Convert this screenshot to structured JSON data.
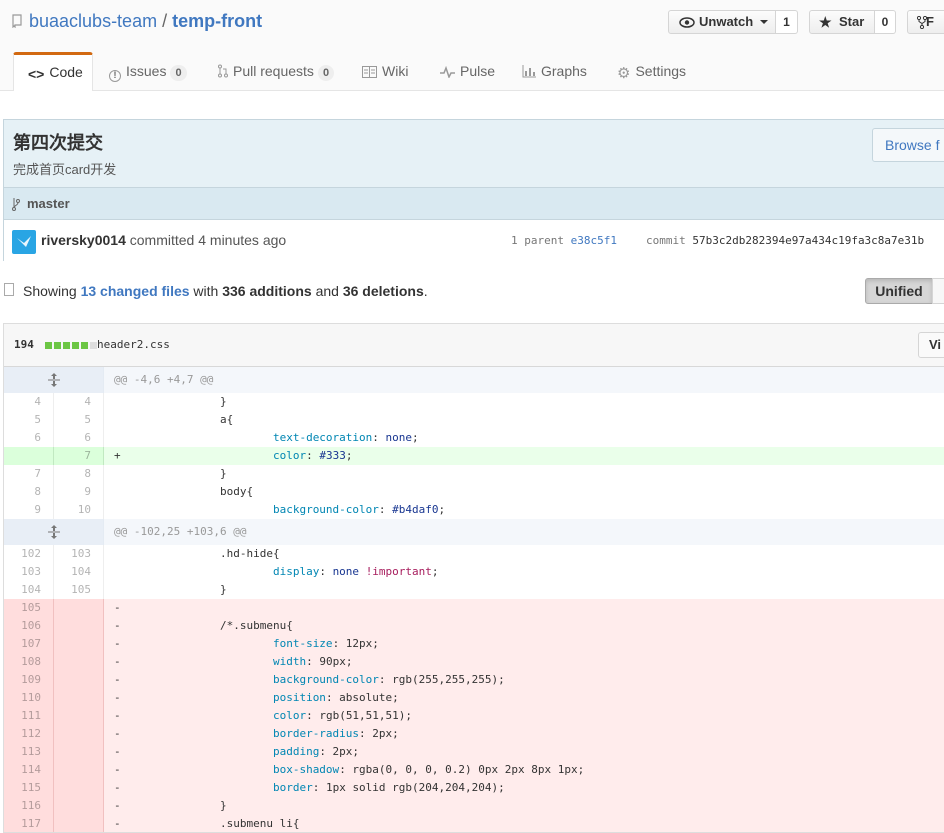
{
  "repo": {
    "owner": "buaaclubs-team",
    "separator": "/",
    "name": "temp-front"
  },
  "actions": {
    "unwatch_label": "Unwatch",
    "watch_count": "1",
    "star_label": "Star",
    "star_count": "0",
    "fork_label": "F"
  },
  "tabs": [
    {
      "label": "Code",
      "icon": "code-icon",
      "selected": true
    },
    {
      "label": "Issues",
      "icon": "issue-icon",
      "count": "0"
    },
    {
      "label": "Pull requests",
      "icon": "pull-request-icon",
      "count": "0"
    },
    {
      "label": "Wiki",
      "icon": "book-icon"
    },
    {
      "label": "Pulse",
      "icon": "pulse-icon"
    },
    {
      "label": "Graphs",
      "icon": "graph-icon"
    },
    {
      "label": "Settings",
      "icon": "gear-icon"
    }
  ],
  "commit": {
    "title": "第四次提交",
    "description": "完成首页card开发",
    "browse_label": "Browse f",
    "branch": "master",
    "author": "riversky0014",
    "committed_text": "committed 4 minutes ago",
    "parent_label": "1 parent",
    "parent_sha": "e38c5f1",
    "commit_label": "commit",
    "commit_sha": "57b3c2db282394e97a434c19fa3c8a7e31b"
  },
  "toc": {
    "showing": "Showing",
    "changed_files": "13 changed files",
    "with": "with",
    "additions": "336 additions",
    "and": "and",
    "deletions": "36 deletions",
    "period": ".",
    "unified_label": "Unified"
  },
  "file": {
    "diffstat": "194",
    "blocks": [
      "add",
      "add",
      "add",
      "add",
      "add",
      "neutral"
    ],
    "name": "header2.css",
    "view_label": "Vi"
  },
  "colors": {
    "add": "#6cc644",
    "neutral": "#dddddd",
    "accent": "#4078c0",
    "tab_accent": "#d26911"
  },
  "diff_rows": [
    {
      "type": "hunk",
      "text": "@@ -4,6 +4,7 @@"
    },
    {
      "type": "ctx",
      "o": "4",
      "n": "4",
      "text": "  \t\t}"
    },
    {
      "type": "ctx",
      "o": "5",
      "n": "5",
      "text": "  \t\ta{"
    },
    {
      "type": "ctx",
      "o": "6",
      "n": "6",
      "text": "  \t\t\ttext-decoration: none;"
    },
    {
      "type": "add",
      "o": "",
      "n": "7",
      "text": "+ \t\t\tcolor: #333;"
    },
    {
      "type": "ctx",
      "o": "7",
      "n": "8",
      "text": "  \t\t}"
    },
    {
      "type": "ctx",
      "o": "8",
      "n": "9",
      "text": "  \t\tbody{"
    },
    {
      "type": "ctx",
      "o": "9",
      "n": "10",
      "text": "  \t\t\tbackground-color: #b4daf0;"
    },
    {
      "type": "hunk",
      "text": "@@ -102,25 +103,6 @@"
    },
    {
      "type": "ctx",
      "o": "102",
      "n": "103",
      "text": "  \t\t.hd-hide{"
    },
    {
      "type": "ctx",
      "o": "103",
      "n": "104",
      "text": "  \t\t\tdisplay: none !important;"
    },
    {
      "type": "ctx",
      "o": "104",
      "n": "105",
      "text": "  \t\t}"
    },
    {
      "type": "del",
      "o": "105",
      "n": "",
      "text": "-"
    },
    {
      "type": "del",
      "o": "106",
      "n": "",
      "text": "- \t\t/*.submenu{"
    },
    {
      "type": "del",
      "o": "107",
      "n": "",
      "text": "- \t\t\tfont-size: 12px;"
    },
    {
      "type": "del",
      "o": "108",
      "n": "",
      "text": "- \t\t\twidth: 90px;"
    },
    {
      "type": "del",
      "o": "109",
      "n": "",
      "text": "- \t\t\tbackground-color: rgb(255,255,255);"
    },
    {
      "type": "del",
      "o": "110",
      "n": "",
      "text": "- \t\t\tposition: absolute;"
    },
    {
      "type": "del",
      "o": "111",
      "n": "",
      "text": "- \t\t\tcolor: rgb(51,51,51);"
    },
    {
      "type": "del",
      "o": "112",
      "n": "",
      "text": "- \t\t\tborder-radius: 2px;"
    },
    {
      "type": "del",
      "o": "113",
      "n": "",
      "text": "- \t\t\tpadding: 2px;"
    },
    {
      "type": "del",
      "o": "114",
      "n": "",
      "text": "- \t\t\tbox-shadow: rgba(0, 0, 0, 0.2) 0px 2px 8px 1px;"
    },
    {
      "type": "del",
      "o": "115",
      "n": "",
      "text": "- \t\t\tborder: 1px solid rgb(204,204,204);"
    },
    {
      "type": "del",
      "o": "116",
      "n": "",
      "text": "- \t\t}"
    },
    {
      "type": "del",
      "o": "117",
      "n": "",
      "text": "- \t\t.submenu li{"
    }
  ]
}
